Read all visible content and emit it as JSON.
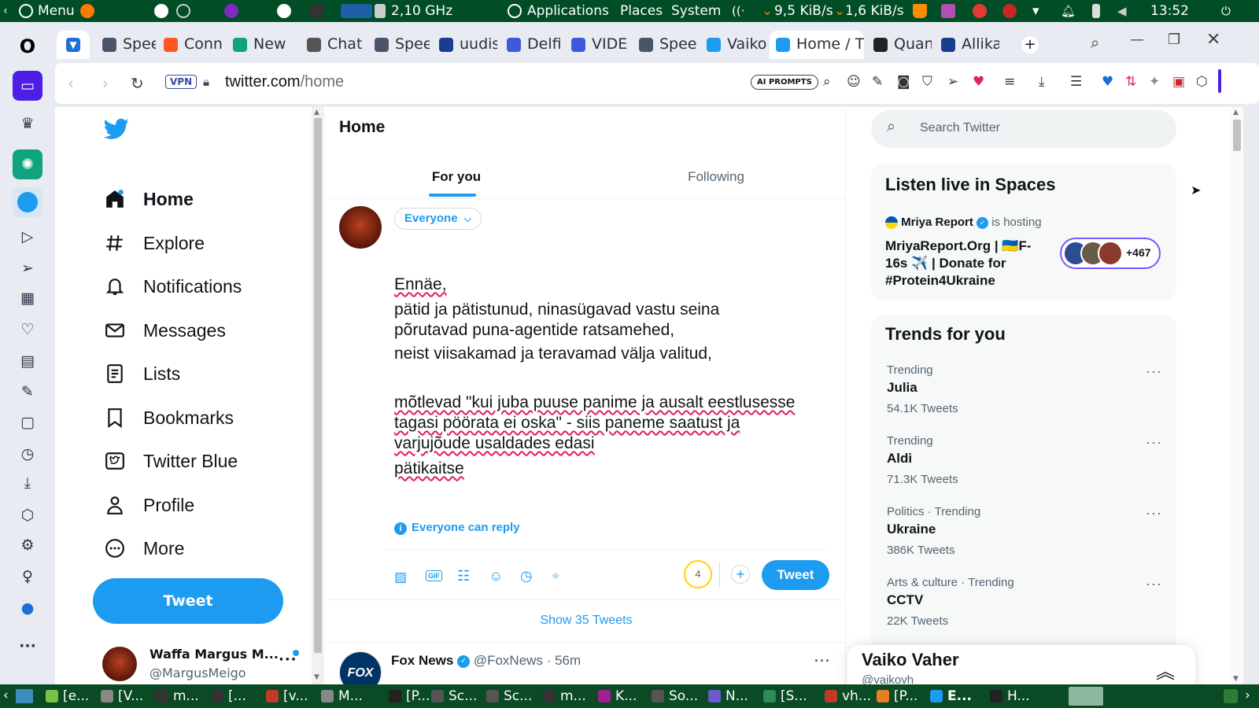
{
  "topbar": {
    "menu_label": "Menu",
    "cpu_freq": "2,10 GHz",
    "applications": "Applications",
    "places": "Places",
    "system": "System",
    "net_down": "9,5 KiB/s",
    "net_up": "1,6 KiB/s",
    "clock": "13:52"
  },
  "tabs": [
    {
      "label": "Spee",
      "color": "#4a5568",
      "icon": "grid-icon"
    },
    {
      "label": "Conn",
      "color": "#ff5722",
      "icon": "square-icon"
    },
    {
      "label": "New",
      "color": "#10a37f",
      "icon": "chatgpt-icon"
    },
    {
      "label": "Chat",
      "color": "#555555",
      "icon": "chat-icon"
    },
    {
      "label": "Spee",
      "color": "#4a5568",
      "icon": "grid-icon"
    },
    {
      "label": "uudis",
      "color": "#1a3d8f",
      "icon": "news-icon"
    },
    {
      "label": "Delfi",
      "color": "#3b5bdb",
      "icon": "delfi-icon"
    },
    {
      "label": "VIDE",
      "color": "#3b5bdb",
      "icon": "delfi-icon"
    },
    {
      "label": "Spee",
      "color": "#4a5568",
      "icon": "grid-icon"
    },
    {
      "label": "Vaiko",
      "color": "#1d9bf0",
      "icon": "twitter-icon"
    },
    {
      "label": "Home / Tv",
      "color": "#1d9bf0",
      "icon": "twitter-icon"
    },
    {
      "label": "Quan",
      "color": "#222222",
      "icon": "wikipedia-icon"
    },
    {
      "label": "Allika",
      "color": "#1a3d8f",
      "icon": "news-icon"
    }
  ],
  "address": {
    "vpn": "VPN",
    "host": "twitter.com",
    "path": "/home",
    "ai_prompts": "AI PROMPTS"
  },
  "nav": {
    "items": [
      {
        "label": "Home",
        "icon": "home-icon"
      },
      {
        "label": "Explore",
        "icon": "hashtag-icon"
      },
      {
        "label": "Notifications",
        "icon": "bell-icon"
      },
      {
        "label": "Messages",
        "icon": "mail-icon"
      },
      {
        "label": "Lists",
        "icon": "list-icon"
      },
      {
        "label": "Bookmarks",
        "icon": "bookmark-icon"
      },
      {
        "label": "Twitter Blue",
        "icon": "twitter-blue-icon"
      },
      {
        "label": "Profile",
        "icon": "person-icon"
      },
      {
        "label": "More",
        "icon": "more-circle-icon"
      }
    ],
    "tweet_button": "Tweet",
    "account_name": "Waffa Margus M...",
    "account_handle": "@MargusMeigo"
  },
  "timeline": {
    "title": "Home",
    "tab_for_you": "For you",
    "tab_following": "Following",
    "audience": "Everyone",
    "compose_lines": [
      "Ennäe,",
      "pätid ja pätistunud, ninasügavad vastu seina",
      "põrutavad puna-agentide ratsamehed,",
      "neist viisakamad ja teravamad välja valitud,",
      "",
      "mõtlevad \"kui juba puuse panime ja ausalt eestlusesse",
      "tagasi pöörata ei oska\" - siis paneme saatust ja",
      "varjujõude usaldades edasi",
      "pätikaitse"
    ],
    "reply_setting": "Everyone can reply",
    "char_remaining": "4",
    "tweet_button": "Tweet",
    "show_more": "Show 35 Tweets",
    "next_tweet": {
      "author": "Fox News",
      "handle": "@FoxNews",
      "time": "56m"
    }
  },
  "right": {
    "search_placeholder": "Search Twitter",
    "spaces_title": "Listen live in Spaces",
    "space_host": "Mriya Report",
    "space_hosting": "is hosting",
    "space_title": "MriyaReport.Org | 🇺🇦F-16s ✈️ | Donate for #Protein4Ukraine",
    "space_count": "+467",
    "trends_title": "Trends for you",
    "trends": [
      {
        "context": "Trending",
        "name": "Julia",
        "count": "54.1K Tweets"
      },
      {
        "context": "Trending",
        "name": "Aldi",
        "count": "71.3K Tweets"
      },
      {
        "context": "Politics · Trending",
        "name": "Ukraine",
        "count": "386K Tweets"
      },
      {
        "context": "Arts & culture · Trending",
        "name": "CCTV",
        "count": "22K Tweets"
      }
    ],
    "messages_drawer_name": "Vaiko Vaher",
    "messages_drawer_handle": "@vaikovh"
  },
  "taskbar": [
    {
      "label": "[e...",
      "color": "#7cc242"
    },
    {
      "label": "[V...",
      "color": "#888888"
    },
    {
      "label": "m...",
      "color": "#333333"
    },
    {
      "label": "[...",
      "color": "#333333"
    },
    {
      "label": "[v...",
      "color": "#c0392b"
    },
    {
      "label": "M...",
      "color": "#888888"
    },
    {
      "label": "[P...",
      "color": "#222222"
    },
    {
      "label": "Sc...",
      "color": "#555555"
    },
    {
      "label": "Sc...",
      "color": "#555555"
    },
    {
      "label": "m...",
      "color": "#333333"
    },
    {
      "label": "K...",
      "color": "#a0208f"
    },
    {
      "label": "So...",
      "color": "#555555"
    },
    {
      "label": "N...",
      "color": "#6a5acd"
    },
    {
      "label": "[S...",
      "color": "#2e8b57"
    },
    {
      "label": "vh...",
      "color": "#c0392b"
    },
    {
      "label": "[P...",
      "color": "#e67e22"
    },
    {
      "label": "E...",
      "color": "#1d9bf0"
    },
    {
      "label": "H...",
      "color": "#222222"
    }
  ],
  "colors": {
    "accent": "#1d9bf0",
    "panel_green": "#004d26",
    "browser_chrome": "#e8ebf1"
  }
}
